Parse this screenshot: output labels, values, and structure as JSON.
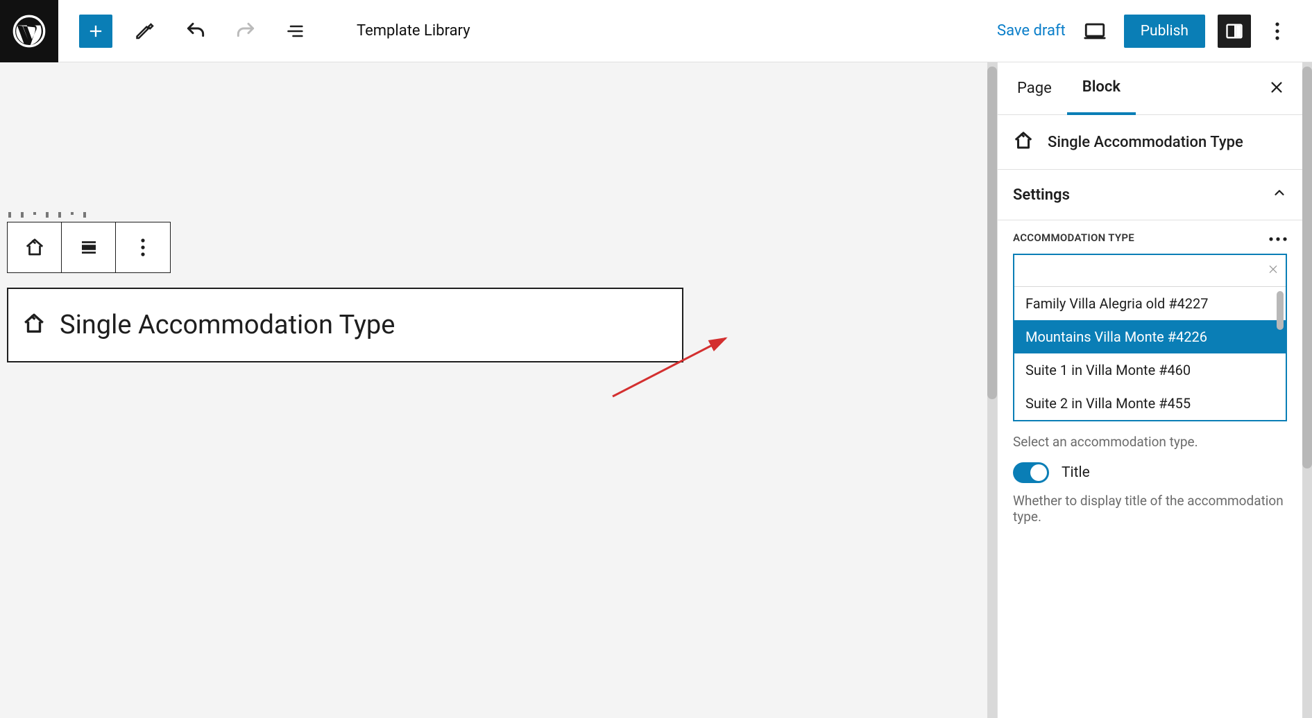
{
  "toolbar": {
    "template_library_label": "Template Library",
    "save_draft_label": "Save draft",
    "publish_label": "Publish"
  },
  "canvas": {
    "block_placeholder_title": "Single Accommodation Type"
  },
  "sidebar": {
    "tabs": [
      {
        "label": "Page",
        "active": false
      },
      {
        "label": "Block",
        "active": true
      }
    ],
    "block_name": "Single Accommodation Type",
    "settings_heading": "Settings",
    "accommodation_type_label": "ACCOMMODATION TYPE",
    "accommodation_options": [
      {
        "label": "Family Villa Alegria old #4227",
        "selected": false
      },
      {
        "label": "Mountains Villa Monte #4226",
        "selected": true
      },
      {
        "label": "Suite 1 in Villa Monte #460",
        "selected": false
      },
      {
        "label": "Suite 2 in Villa Monte #455",
        "selected": false
      }
    ],
    "accommodation_help": "Select an accommodation type.",
    "title_toggle_label": "Title",
    "title_toggle_help": "Whether to display title of the accommodation type."
  },
  "colors": {
    "accent": "#0a7eb6",
    "annotation": "#d32f2f"
  }
}
